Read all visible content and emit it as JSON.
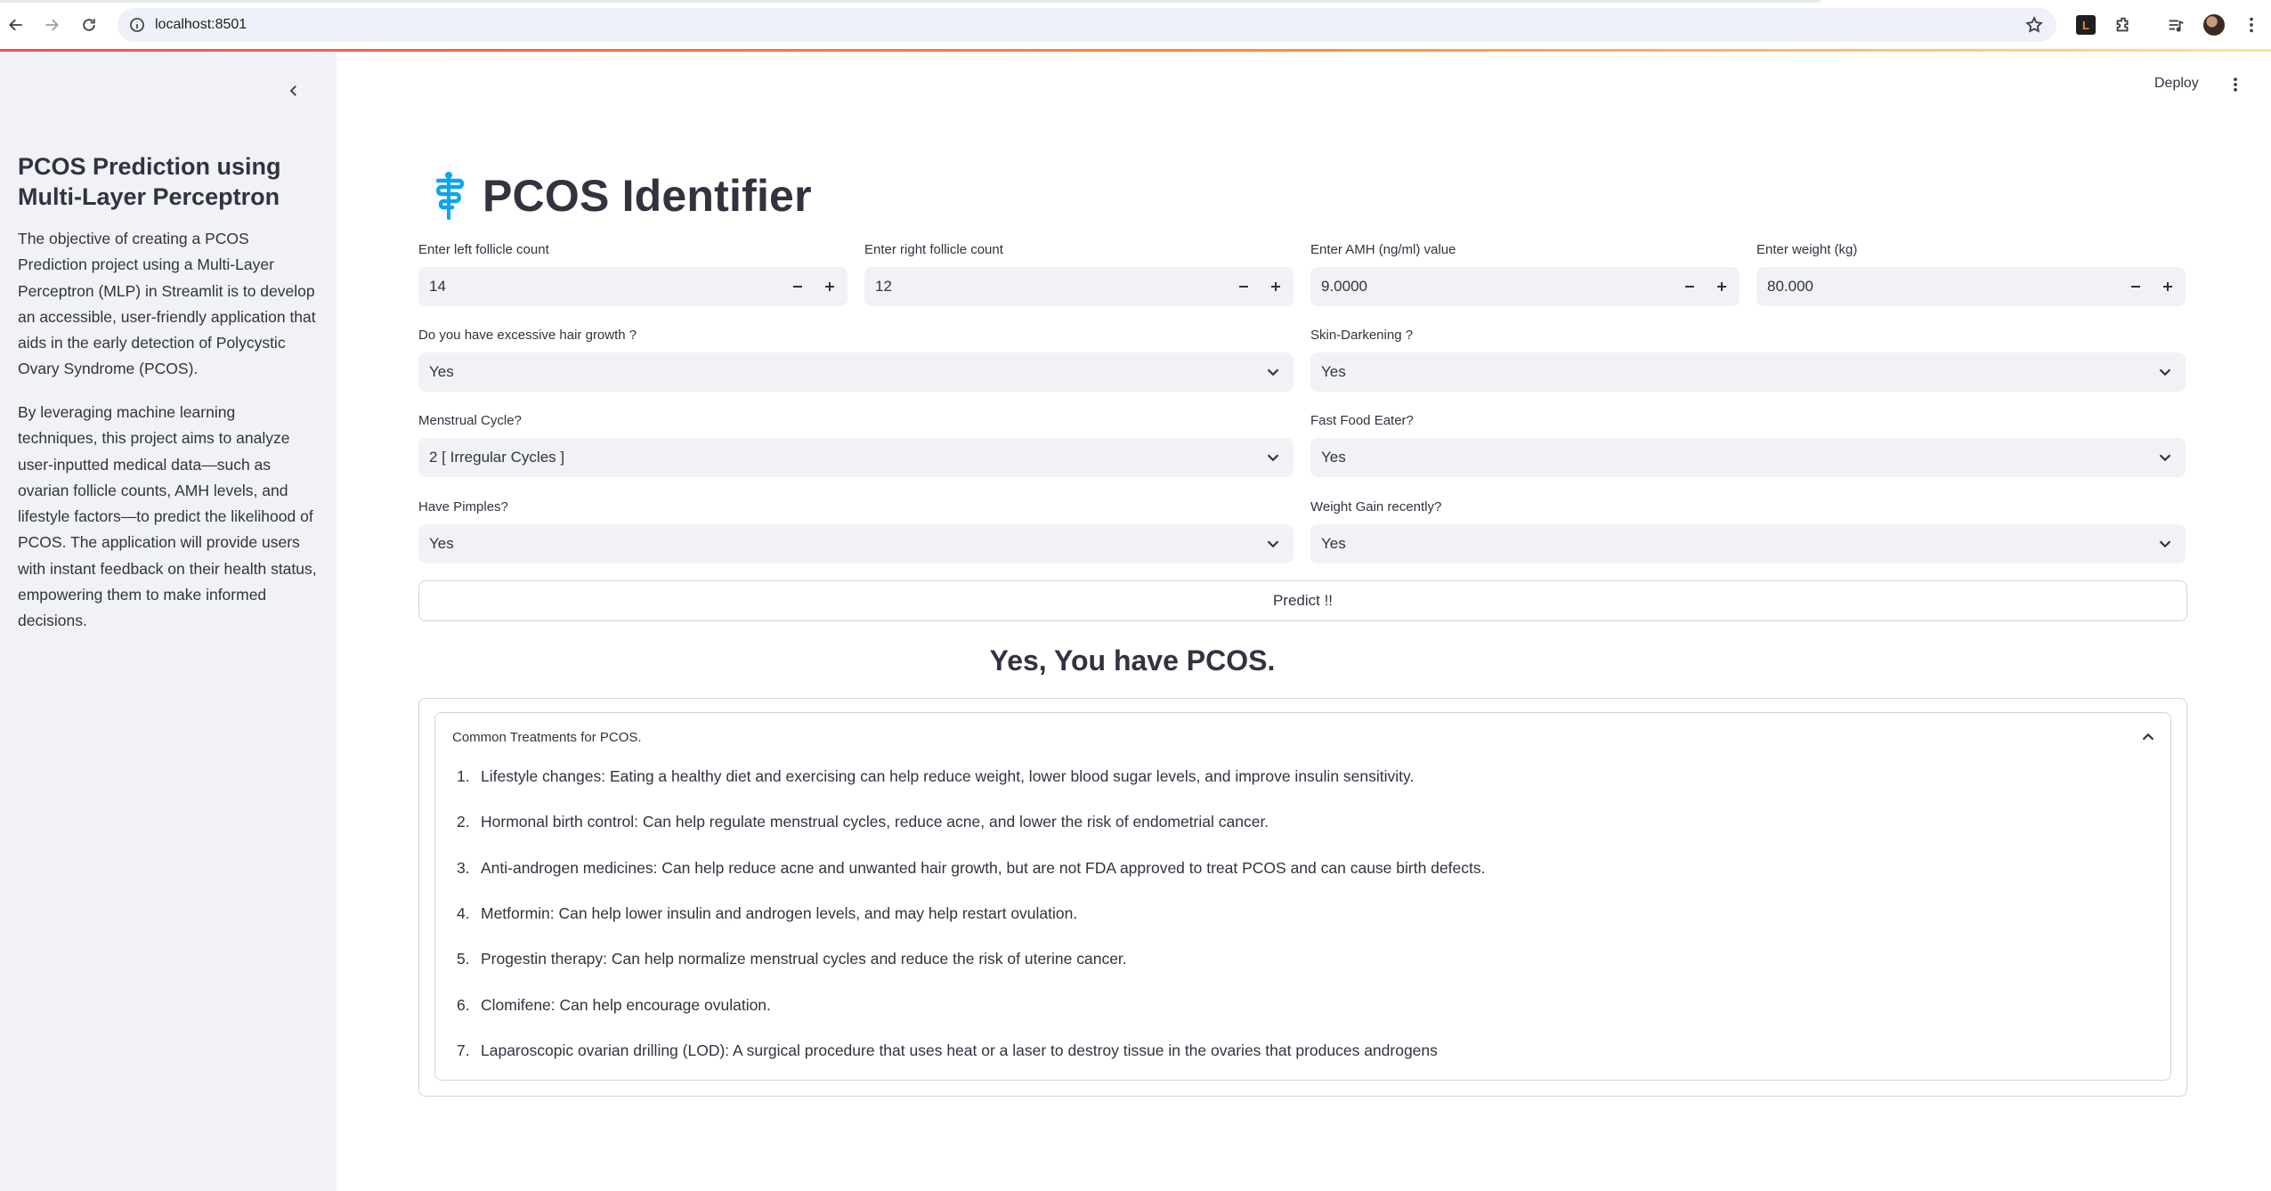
{
  "browser": {
    "url": "localhost:8501"
  },
  "header": {
    "deploy_label": "Deploy"
  },
  "sidebar": {
    "title": "PCOS Prediction using Multi-Layer Perceptron",
    "paragraph1": "The objective of creating a PCOS Prediction project using a Multi-Layer Perceptron (MLP) in Streamlit is to develop an accessible, user-friendly application that aids in the early detection of Polycystic Ovary Syndrome (PCOS).",
    "paragraph2": "By leveraging machine learning techniques, this project aims to analyze user-inputted medical data—such as ovarian follicle counts, AMH levels, and lifestyle factors—to predict the likelihood of PCOS. The application will provide users with instant feedback on their health status, empowering them to make informed decisions."
  },
  "main": {
    "title": "PCOS Identifier",
    "inputs": {
      "left_follicle": {
        "label": "Enter left follicle count",
        "value": "14"
      },
      "right_follicle": {
        "label": "Enter right follicle count",
        "value": "12"
      },
      "amh": {
        "label": "Enter AMH (ng/ml) value",
        "value": "9.0000"
      },
      "weight": {
        "label": "Enter weight (kg)",
        "value": "80.000"
      }
    },
    "selects": {
      "hair_growth": {
        "label": "Do you have excessive hair growth ?",
        "value": "Yes"
      },
      "skin_darkening": {
        "label": "Skin-Darkening ?",
        "value": "Yes"
      },
      "menstrual_cycle": {
        "label": "Menstrual Cycle?",
        "value": "2 [ Irregular Cycles ]"
      },
      "fast_food": {
        "label": "Fast Food Eater?",
        "value": "Yes"
      },
      "pimples": {
        "label": "Have Pimples?",
        "value": "Yes"
      },
      "weight_gain": {
        "label": "Weight Gain recently?",
        "value": "Yes"
      }
    },
    "predict_label": "Predict !!",
    "result": "Yes, You have PCOS.",
    "expander": {
      "title": "Common Treatments for PCOS.",
      "items": [
        {
          "num": "1.",
          "text": "Lifestyle changes: Eating a healthy diet and exercising can help reduce weight, lower blood sugar levels, and improve insulin sensitivity."
        },
        {
          "num": "2.",
          "text": "Hormonal birth control: Can help regulate menstrual cycles, reduce acne, and lower the risk of endometrial cancer."
        },
        {
          "num": "3.",
          "text": "Anti-androgen medicines: Can help reduce acne and unwanted hair growth, but are not FDA approved to treat PCOS and can cause birth defects."
        },
        {
          "num": "4.",
          "text": "Metformin: Can help lower insulin and androgen levels, and may help restart ovulation."
        },
        {
          "num": "5.",
          "text": "Progestin therapy: Can help normalize menstrual cycles and reduce the risk of uterine cancer."
        },
        {
          "num": "6.",
          "text": "Clomifene: Can help encourage ovulation."
        },
        {
          "num": "7.",
          "text": "Laparoscopic ovarian drilling (LOD): A surgical procedure that uses heat or a laser to destroy tissue in the ovaries that produces androgens"
        }
      ]
    }
  },
  "colors": {
    "accent_gradient_start": "#ff4b4b",
    "accent_gradient_end": "#ffe29a",
    "sidebar_bg": "#f0f2f6",
    "input_bg": "#f0f2f6",
    "text": "#31333f",
    "caduceus": "#0ea5e9"
  },
  "icons": {
    "back": "arrow-left-icon",
    "forward": "arrow-right-icon",
    "reload": "reload-icon",
    "site_info": "site-info-icon",
    "bookmark": "star-icon",
    "title_emoji": "caduceus-icon"
  }
}
